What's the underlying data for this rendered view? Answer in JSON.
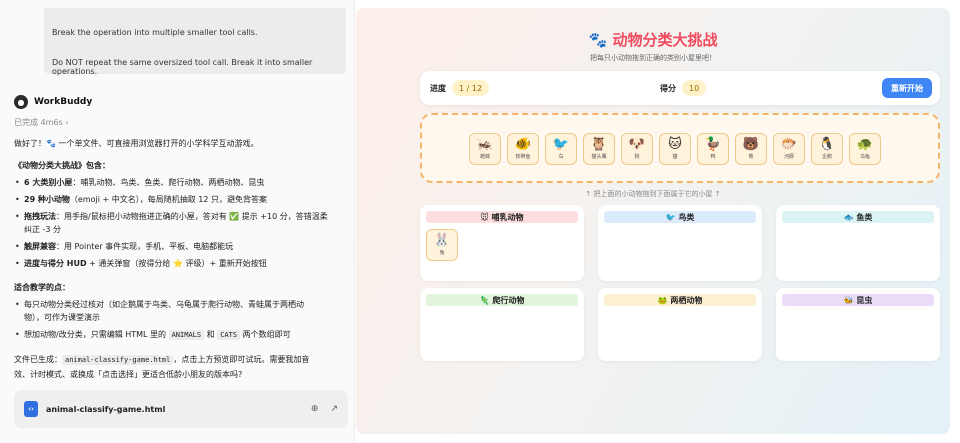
{
  "chat": {
    "tool_msg": {
      "line1": "Break the operation into multiple smaller tool calls.",
      "line2": "Do NOT repeat the same oversized tool call. Break it into smaller operations."
    },
    "agent_name": "WorkBuddy",
    "status": "已完成 4m6s",
    "intro": "做好了！🐾 一个单文件、可直接用浏览器打开的小学科学互动游戏。",
    "contains_title": "《动物分类大挑战》包含：",
    "bullets": [
      {
        "bold": "6 大类别小屋",
        "text": "：哺乳动物、鸟类、鱼类、爬行动物、两栖动物、昆虫"
      },
      {
        "bold": "29 种小动物",
        "text": "（emoji + 中文名），每局随机抽取 12 只，避免背答案"
      },
      {
        "bold": "拖拽玩法",
        "text": "：用手指/鼠标把小动物拖进正确的小屋，答对有 ✅ 提示 +10 分，答错温柔"
      },
      {
        "bold": "",
        "text": "纠正 -3 分"
      },
      {
        "bold": "触屏兼容",
        "text": "：用 Pointer 事件实现，手机、平板、电脑都能玩"
      },
      {
        "bold": "进度与得分 HUD",
        "text": " + 通关弹窗（按得分给 ⭐ 评级）+ 重新开始按钮"
      }
    ],
    "teaching_title": "适合教学的点：",
    "teaching": [
      "每只动物分类经过核对（如企鹅属于鸟类、乌龟属于爬行动物、青蛙属于两栖动",
      "物），可作为课堂演示",
      "想加动物/改分类，只需编辑 HTML 里的"
    ],
    "code_animals": "ANIMALS",
    "and_word": "和",
    "code_cats": "CATS",
    "tail_text": "两个数组即可",
    "file_line_a": "文件已生成：",
    "file_code": "animal-classify-game.html",
    "file_line_b": "，点击上方预览即可试玩。需要我加音",
    "file_line_c": "效、计时模式、或换成「点击选择」更适合低龄小朋友的版本吗?",
    "file_card_name": "animal-classify-game.html"
  },
  "game": {
    "title": "🐾 动物分类大挑战",
    "subtitle": "把每只小动物拖到正确的类别小屋里吧！",
    "progress_label": "进度",
    "progress_value": "1 / 12",
    "score_label": "得分",
    "score_value": "10",
    "restart_label": "重新开始",
    "pool_animals": [
      {
        "emoji": "🦗",
        "name": "蟋蟀"
      },
      {
        "emoji": "🐠",
        "name": "热带鱼"
      },
      {
        "emoji": "🐦",
        "name": "鸟"
      },
      {
        "emoji": "🦉",
        "name": "猫头鹰"
      },
      {
        "emoji": "🐶",
        "name": "狗"
      },
      {
        "emoji": "🐱",
        "name": "猫"
      },
      {
        "emoji": "🦆",
        "name": "鸭"
      },
      {
        "emoji": "🐻",
        "name": "熊"
      },
      {
        "emoji": "🐡",
        "name": "河豚"
      },
      {
        "emoji": "🐧",
        "name": "企鹅"
      },
      {
        "emoji": "🐢",
        "name": "乌龟"
      }
    ],
    "hint": "↑ 把上面的小动物拖到下面属于它的小屋 ↑",
    "bins": [
      {
        "label": "🐭 哺乳动物",
        "color": "#fcdede"
      },
      {
        "label": "🐦 鸟类",
        "color": "#dcebfb"
      },
      {
        "label": "🐟 鱼类",
        "color": "#dcf4f3"
      },
      {
        "label": "🦎 爬行动物",
        "color": "#e2f4dc"
      },
      {
        "label": "🐸 两栖动物",
        "color": "#fbf0d2"
      },
      {
        "label": "🐝 昆虫",
        "color": "#eadcf8"
      }
    ],
    "placed": {
      "emoji": "🐰",
      "name": "兔"
    }
  }
}
